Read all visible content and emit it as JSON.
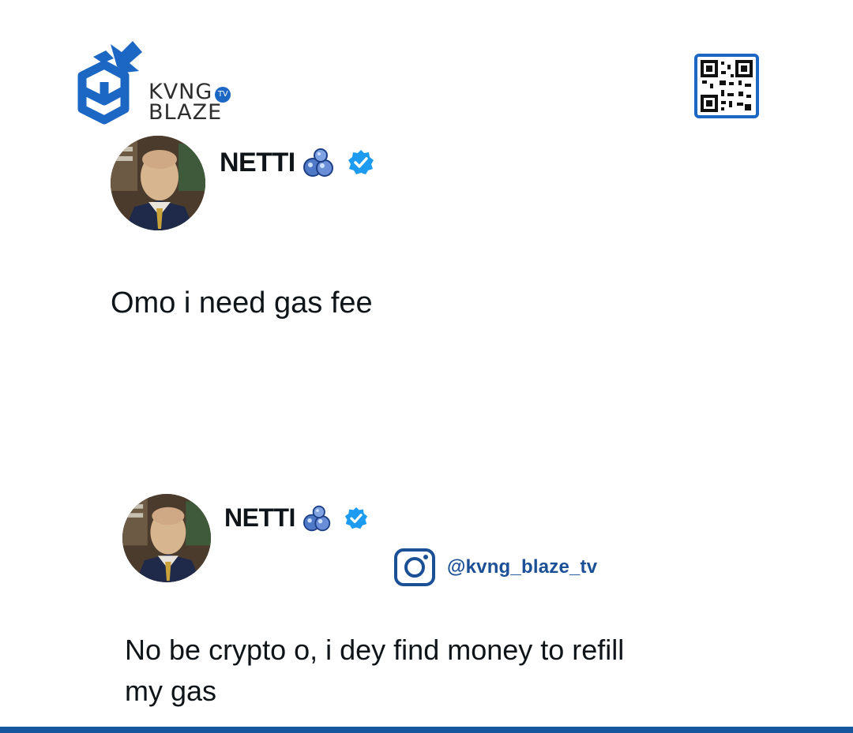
{
  "brand": {
    "logo_line1": "KVNG",
    "logo_badge": "TV",
    "logo_line2": "BLAZE",
    "accent_color": "#1b67c3",
    "qr_icon": "qr-code-icon"
  },
  "tweets": [
    {
      "author": "NETTI",
      "badge_icon": "verified-icon",
      "emoji_icon": "bubbles-icon",
      "text": "Omo i need gas fee"
    },
    {
      "author": "NETTI",
      "badge_icon": "verified-icon",
      "emoji_icon": "bubbles-icon",
      "text": "No be crypto o, i dey find money to refill\nmy gas"
    }
  ],
  "instagram": {
    "icon": "instagram-icon",
    "handle": "@kvng_blaze_tv"
  }
}
